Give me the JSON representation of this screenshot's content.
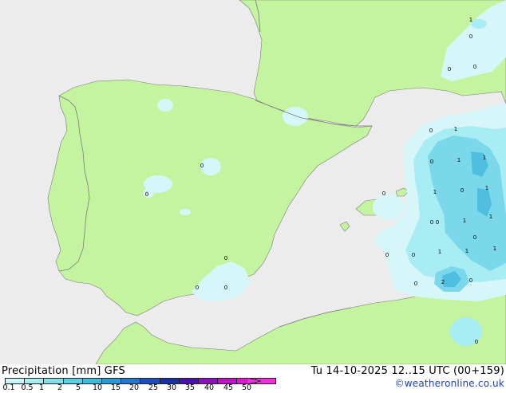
{
  "footer": {
    "title": "Precipitation [mm]  GFS",
    "datetime": "Tu 14-10-2025 12..15 UTC (00+159)",
    "credit": "©weatheronline.co.uk"
  },
  "legend": {
    "tick_labels": [
      "0.1",
      "0.5",
      "1",
      "2",
      "5",
      "10",
      "15",
      "20",
      "25",
      "30",
      "35",
      "40",
      "45",
      "50"
    ],
    "colors": [
      "#c8f5f8",
      "#a2ecf2",
      "#7fe0ec",
      "#5ad0e6",
      "#3cbcde",
      "#2a9bd4",
      "#2277cc",
      "#1b4fc0",
      "#1a2fa8",
      "#4a10b0",
      "#8a10c0",
      "#c010c8",
      "#e018d0",
      "#f030e0"
    ]
  },
  "map": {
    "colors": {
      "sea": "#ececec",
      "land": "#c5f4a0",
      "precip_light": "#d6f6fa",
      "precip_medium": "#a8ecf4",
      "precip_heavy": "#7ad8ea",
      "precip_strong": "#4fbfe0",
      "border": "#7a7a7a"
    },
    "labels": [
      {
        "text": "0"
      },
      {
        "text": "0"
      },
      {
        "text": "0"
      },
      {
        "text": "0"
      },
      {
        "text": "0"
      },
      {
        "text": "0"
      },
      {
        "text": "1"
      },
      {
        "text": "0"
      },
      {
        "text": "1"
      },
      {
        "text": "1"
      },
      {
        "text": "1"
      },
      {
        "text": "1"
      },
      {
        "text": "0"
      },
      {
        "text": "1"
      },
      {
        "text": "0"
      },
      {
        "text": "1"
      },
      {
        "text": "1"
      },
      {
        "text": "0"
      },
      {
        "text": "1"
      },
      {
        "text": "1"
      },
      {
        "text": "1"
      },
      {
        "text": "0"
      },
      {
        "text": "0"
      },
      {
        "text": "0"
      },
      {
        "text": "0"
      },
      {
        "text": "0"
      },
      {
        "text": "0"
      },
      {
        "text": "0"
      },
      {
        "text": "2"
      },
      {
        "text": "0"
      },
      {
        "text": "0"
      },
      {
        "text": "0"
      }
    ]
  }
}
